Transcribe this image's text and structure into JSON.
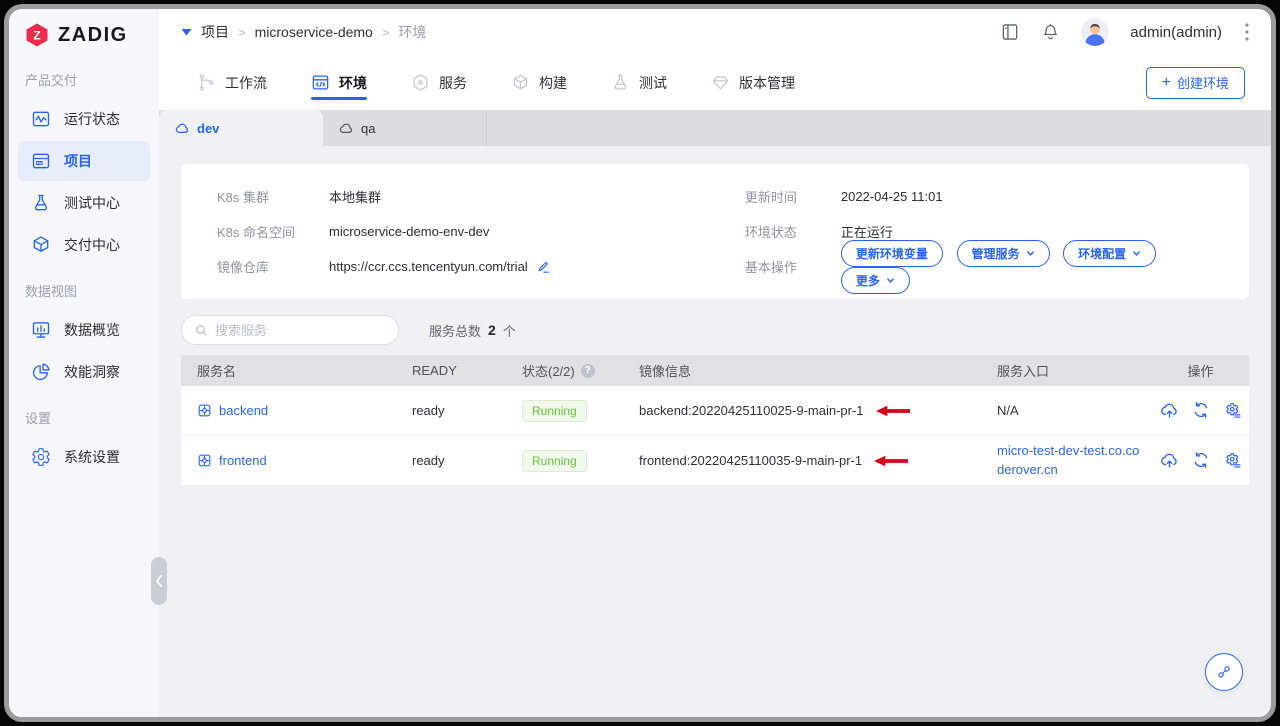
{
  "colors": {
    "accent": "#2a64f6",
    "logo_red": "#ee2b4c",
    "success_text": "#67c23a",
    "success_bg": "#f0f9eb",
    "arrow_red": "#d9001b",
    "sidebar_bg": "#f5f7fa",
    "strip_bg": "#dcdddf"
  },
  "brand": {
    "name": "ZADIG"
  },
  "sidebar": {
    "sections": [
      {
        "title": "产品交付",
        "items": [
          {
            "label": "运行状态"
          },
          {
            "label": "项目"
          },
          {
            "label": "测试中心"
          },
          {
            "label": "交付中心"
          }
        ]
      },
      {
        "title": "数据视图",
        "items": [
          {
            "label": "数据概览"
          },
          {
            "label": "效能洞察"
          }
        ]
      },
      {
        "title": "设置",
        "items": [
          {
            "label": "系统设置"
          }
        ]
      }
    ]
  },
  "header": {
    "breadcrumb": [
      "项目",
      "microservice-demo",
      "环境"
    ],
    "separator": ">",
    "user": "admin(admin)"
  },
  "tabs": [
    {
      "label": "工作流"
    },
    {
      "label": "环境"
    },
    {
      "label": "服务"
    },
    {
      "label": "构建"
    },
    {
      "label": "测试"
    },
    {
      "label": "版本管理"
    }
  ],
  "create_env": {
    "icon": "+",
    "label": "创建环境"
  },
  "env_tabs": [
    {
      "label": "dev"
    },
    {
      "label": "qa"
    }
  ],
  "env_info": {
    "left": [
      {
        "label": "K8s 集群",
        "value": "本地集群"
      },
      {
        "label": "K8s 命名空间",
        "value": "microservice-demo-env-dev"
      },
      {
        "label": "镜像仓库",
        "value": "https://ccr.ccs.tencentyun.com/trial"
      }
    ],
    "right": [
      {
        "label": "更新时间",
        "value": "2022-04-25 11:01"
      },
      {
        "label": "环境状态",
        "value": "正在运行"
      }
    ],
    "actions_label": "基本操作",
    "actions": [
      {
        "label": "更新环境变量"
      },
      {
        "label": "管理服务"
      },
      {
        "label": "环境配置"
      },
      {
        "label": "更多"
      }
    ]
  },
  "toolbar": {
    "search_placeholder": "搜索服务",
    "total_label": "服务总数",
    "total_count": "2",
    "total_unit": "个"
  },
  "table": {
    "help_glyph": "?",
    "headers": [
      "服务名",
      "READY",
      "状态(2/2)",
      "镜像信息",
      "服务入口",
      "操作"
    ],
    "rows": [
      {
        "name": "backend",
        "ready": "ready",
        "status": "Running",
        "image": "backend:20220425110025-9-main-pr-1",
        "entry": "N/A"
      },
      {
        "name": "frontend",
        "ready": "ready",
        "status": "Running",
        "image": "frontend:20220425110035-9-main-pr-1",
        "entry": "micro-test-dev-test.co.coderover.cn"
      }
    ]
  }
}
